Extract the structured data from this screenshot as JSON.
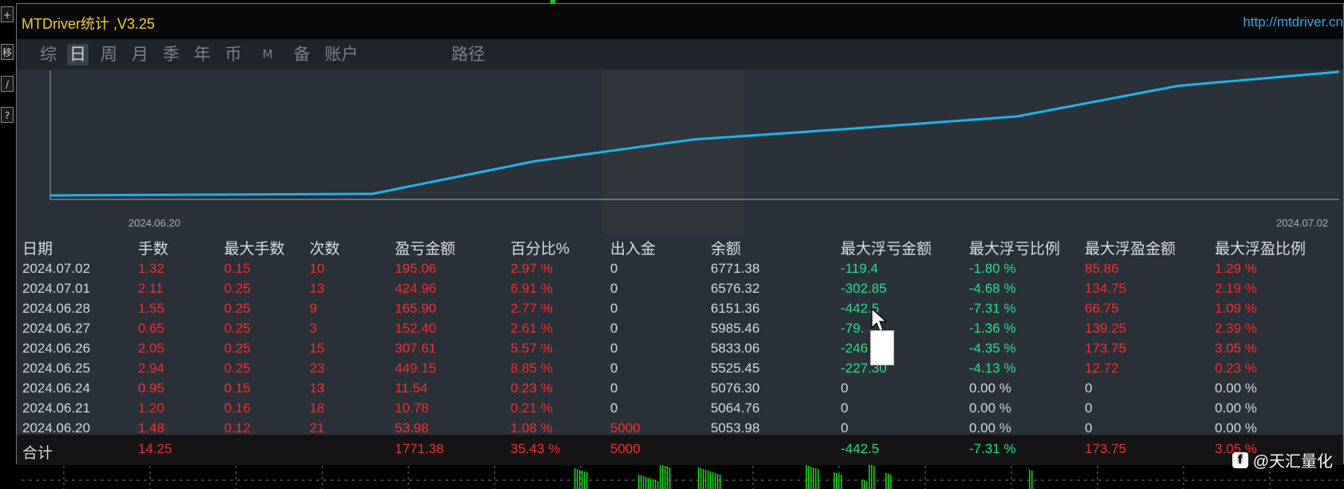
{
  "window": {
    "title": "MTDriver统计 ,V3.25",
    "site": "http://mtdriver.cn"
  },
  "side_buttons": [
    "+",
    "移",
    "/",
    "?"
  ],
  "tabs": [
    {
      "label": "综",
      "active": false
    },
    {
      "label": "日",
      "active": true
    },
    {
      "label": "周",
      "active": false
    },
    {
      "label": "月",
      "active": false
    },
    {
      "label": "季",
      "active": false
    },
    {
      "label": "年",
      "active": false
    },
    {
      "label": "币",
      "active": false
    },
    {
      "label": "M",
      "active": false
    },
    {
      "label": "备",
      "active": false
    },
    {
      "label": "账户",
      "active": false
    },
    {
      "label": "路径",
      "active": false
    }
  ],
  "chart_data": {
    "type": "line",
    "x": [
      "2024.06.20",
      "2024.06.21",
      "2024.06.24",
      "2024.06.25",
      "2024.06.26",
      "2024.06.27",
      "2024.06.28",
      "2024.07.01",
      "2024.07.02"
    ],
    "series": [
      {
        "values": [
          5053.98,
          5064.76,
          5076.3,
          5525.45,
          5833.06,
          5985.46,
          6151.36,
          6576.32,
          6771.38
        ],
        "color": "#1ab4ec"
      }
    ],
    "x_start_label": "2024.06.20",
    "x_end_label": "2024.07.02",
    "grid": false
  },
  "table": {
    "headers": [
      "日期",
      "手数",
      "最大手数",
      "次数",
      "盈亏金额",
      "百分比%",
      "出入金",
      "余额",
      "最大浮亏金额",
      "最大浮亏比例",
      "最大浮盈金额",
      "最大浮盈比例"
    ],
    "rows": [
      [
        "2024.07.02",
        "1.32",
        "0.15",
        "10",
        "195.06",
        "2.97 %",
        "0",
        "6771.38",
        "-119.4",
        "-1.80 %",
        "85.86",
        "1.29 %"
      ],
      [
        "2024.07.01",
        "2.11",
        "0.25",
        "13",
        "424.96",
        "6.91 %",
        "0",
        "6576.32",
        "-302.85",
        "-4.68 %",
        "134.75",
        "2.19 %"
      ],
      [
        "2024.06.28",
        "1.55",
        "0.25",
        "9",
        "165.90",
        "2.77 %",
        "0",
        "6151.36",
        "-442.5",
        "-7.31 %",
        "66.75",
        "1.09 %"
      ],
      [
        "2024.06.27",
        "0.65",
        "0.25",
        "3",
        "152.40",
        "2.61 %",
        "0",
        "5985.46",
        "-79.",
        "-1.36 %",
        "139.25",
        "2.39 %"
      ],
      [
        "2024.06.26",
        "2.05",
        "0.25",
        "15",
        "307.61",
        "5.57 %",
        "0",
        "5833.06",
        "-246",
        "-4.35 %",
        "173.75",
        "3.05 %"
      ],
      [
        "2024.06.25",
        "2.94",
        "0.25",
        "23",
        "449.15",
        "8.85 %",
        "0",
        "5525.45",
        "-227.30",
        "-4.13 %",
        "12.72",
        "0.23 %"
      ],
      [
        "2024.06.24",
        "0.95",
        "0.15",
        "13",
        "11.54",
        "0.23 %",
        "0",
        "5076.30",
        "0",
        "0.00 %",
        "0",
        "0.00 %"
      ],
      [
        "2024.06.21",
        "1.20",
        "0.16",
        "18",
        "10.78",
        "0.21 %",
        "0",
        "5064.76",
        "0",
        "0.00 %",
        "0",
        "0.00 %"
      ],
      [
        "2024.06.20",
        "1.48",
        "0.12",
        "21",
        "53.98",
        "1.08 %",
        "5000",
        "5053.98",
        "0",
        "0.00 %",
        "0",
        "0.00 %"
      ]
    ],
    "total": [
      "合计",
      "14.25",
      "",
      "",
      "1771.38",
      "35.43 %",
      "5000",
      "",
      "-442.5",
      "-7.31 %",
      "173.75",
      "3.05 %"
    ]
  },
  "watermark": {
    "icon": "f",
    "text": "@天汇量化"
  },
  "colors": {
    "positive": "#ff2a2a",
    "negative": "#1fe08a",
    "neutral": "#d3d7da",
    "title": "#f2d21c",
    "link": "#36a9ee"
  }
}
